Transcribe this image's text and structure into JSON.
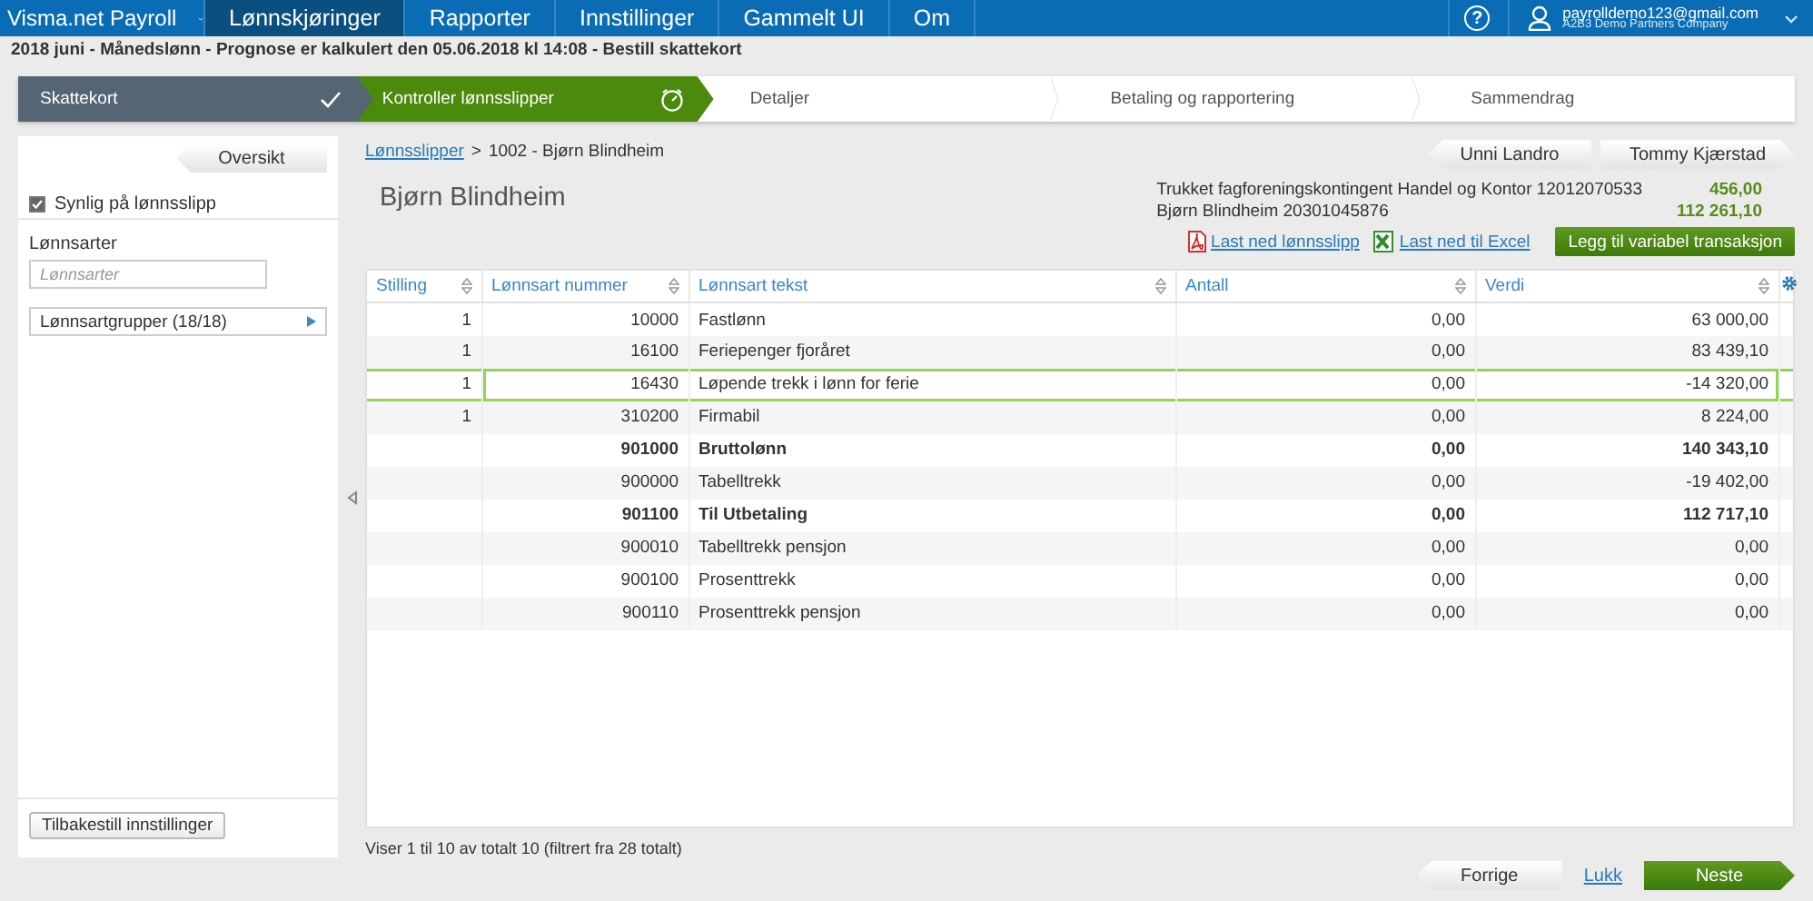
{
  "top_nav": {
    "brand": "Visma.net Payroll",
    "items": [
      {
        "label": "Lønnskjøringer",
        "selected": true
      },
      {
        "label": "Rapporter",
        "selected": false
      },
      {
        "label": "Innstillinger",
        "selected": false
      },
      {
        "label": "Gammelt UI",
        "selected": false
      },
      {
        "label": "Om",
        "selected": false
      }
    ],
    "help": "?",
    "user": {
      "email": "payrolldemo123@gmail.com",
      "company": "A2B3 Demo Partners Company"
    }
  },
  "subtitle": "2018 juni - Månedslønn - Prognose er kalkulert den 05.06.2018 kl 14:08 - Bestill skattekort",
  "steps": [
    {
      "label": "Skattekort",
      "kind": "done"
    },
    {
      "label": "Kontroller lønnsslipper",
      "kind": "active"
    },
    {
      "label": "Detaljer",
      "kind": "todo"
    },
    {
      "label": "Betaling og rapportering",
      "kind": "todo"
    },
    {
      "label": "Sammendrag",
      "kind": "todo"
    }
  ],
  "sidebar": {
    "back_button": "Oversikt",
    "visible_checkbox": {
      "label": "Synlig på lønnsslipp",
      "checked": true
    },
    "filter": {
      "label": "Lønnsarter",
      "placeholder": "Lønnsarter"
    },
    "groups": {
      "label": "Lønnsartgrupper (18/18)",
      "expanded": false
    },
    "reset_button": "Tilbakestill innstillinger"
  },
  "breadcrumb": {
    "link": "Lønnsslipper",
    "separator": ">",
    "current": "1002 - Bjørn Blindheim"
  },
  "employee_name": "Bjørn Blindheim",
  "nav_buttons": [
    "Unni Landro",
    "Tommy Kjærstad"
  ],
  "payments": [
    {
      "text": "Trukket fagforeningskontingent Handel og Kontor 12012070533",
      "amount": "456,00"
    },
    {
      "text": "Bjørn Blindheim 20301045876",
      "amount": "112 261,10"
    }
  ],
  "links": [
    {
      "kind": "pdf",
      "label": "Last ned lønnsslipp"
    },
    {
      "kind": "excel",
      "label": "Last ned til Excel"
    }
  ],
  "add_button": "Legg til variabel transaksjon",
  "table": {
    "columns": [
      {
        "label": "Stilling",
        "kind": "number"
      },
      {
        "label": "Lønnsart nummer",
        "kind": "number"
      },
      {
        "label": "Lønnsart tekst",
        "kind": "text"
      },
      {
        "label": "Antall",
        "kind": "number"
      },
      {
        "label": "Verdi",
        "kind": "number"
      }
    ],
    "rows": [
      {
        "kind": "line",
        "selected": false,
        "cells": [
          "1",
          "10000",
          "Fastlønn",
          "0,00",
          "63 000,00"
        ]
      },
      {
        "kind": "line",
        "selected": false,
        "cells": [
          "1",
          "16100",
          "Feriepenger fjoråret",
          "0,00",
          "83 439,10"
        ]
      },
      {
        "kind": "line",
        "selected": true,
        "cells": [
          "1",
          "16430",
          "Løpende trekk i lønn for ferie",
          "0,00",
          "-14 320,00"
        ]
      },
      {
        "kind": "line",
        "selected": false,
        "cells": [
          "1",
          "310200",
          "Firmabil",
          "0,00",
          "8 224,00"
        ]
      },
      {
        "kind": "total",
        "selected": false,
        "cells": [
          null,
          "901000",
          "Bruttolønn",
          "0,00",
          "140 343,10"
        ]
      },
      {
        "kind": "line",
        "selected": false,
        "cells": [
          null,
          "900000",
          "Tabelltrekk",
          "0,00",
          "-19 402,00"
        ]
      },
      {
        "kind": "total",
        "selected": false,
        "cells": [
          null,
          "901100",
          "Til Utbetaling",
          "0,00",
          "112 717,10"
        ]
      },
      {
        "kind": "line",
        "selected": false,
        "cells": [
          null,
          "900010",
          "Tabelltrekk pensjon",
          "0,00",
          "0,00"
        ]
      },
      {
        "kind": "line",
        "selected": false,
        "cells": [
          null,
          "900100",
          "Prosenttrekk",
          "0,00",
          "0,00"
        ]
      },
      {
        "kind": "line",
        "selected": false,
        "cells": [
          null,
          "900110",
          "Prosenttrekk pensjon",
          "0,00",
          "0,00"
        ]
      }
    ]
  },
  "status_text": "Viser 1 til 10 av totalt 10 (filtrert fra 28 totalt)",
  "footer": {
    "prev_button": "Forrige",
    "close_link": "Lukk",
    "next_button": "Neste"
  }
}
